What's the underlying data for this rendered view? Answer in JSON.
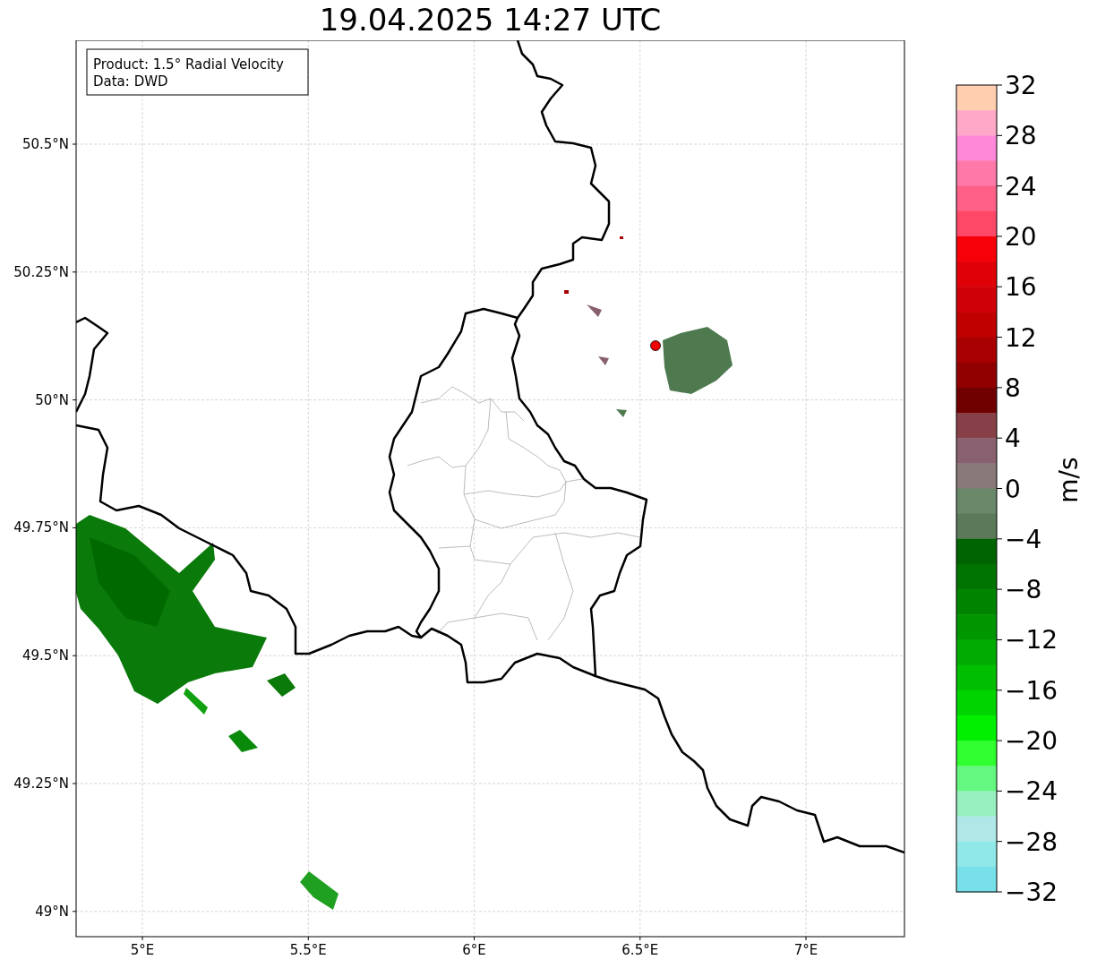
{
  "title": "19.04.2025 14:27 UTC",
  "legend": [
    "Product: 1.5° Radial Velocity",
    "Data: DWD"
  ],
  "axes": {
    "x_ticks": [
      "5°E",
      "5.5°E",
      "6°E",
      "6.5°E",
      "7°E"
    ],
    "y_ticks": [
      "50.5°N",
      "50.25°N",
      "50°N",
      "49.75°N",
      "49.5°N",
      "49.25°N",
      "49°N"
    ]
  },
  "colorbar": {
    "label": "m/s",
    "ticks": [
      "32",
      "28",
      "24",
      "20",
      "16",
      "12",
      "8",
      "4",
      "0",
      "−4",
      "−8",
      "−12",
      "−16",
      "−20",
      "−24",
      "−28",
      "−32"
    ],
    "bins": [
      {
        "color": "#ffcfb0"
      },
      {
        "color": "#ffa8c8"
      },
      {
        "color": "#ff88d8"
      },
      {
        "color": "#ff78a8"
      },
      {
        "color": "#ff6088"
      },
      {
        "color": "#ff4868"
      },
      {
        "color": "#f80008"
      },
      {
        "color": "#e00008"
      },
      {
        "color": "#d00008"
      },
      {
        "color": "#c00000"
      },
      {
        "color": "#a80000"
      },
      {
        "color": "#900000"
      },
      {
        "color": "#700000"
      },
      {
        "color": "#884048"
      },
      {
        "color": "#886070"
      },
      {
        "color": "#887878"
      },
      {
        "color": "#6a886a"
      },
      {
        "color": "#5a7a5a"
      },
      {
        "color": "#006400"
      },
      {
        "color": "#007400"
      },
      {
        "color": "#008400"
      },
      {
        "color": "#009600"
      },
      {
        "color": "#00aa00"
      },
      {
        "color": "#00be00"
      },
      {
        "color": "#00d400"
      },
      {
        "color": "#00f000"
      },
      {
        "color": "#30ff30"
      },
      {
        "color": "#64f880"
      },
      {
        "color": "#98f0c0"
      },
      {
        "color": "#b0e8e8"
      },
      {
        "color": "#90e8e8"
      },
      {
        "color": "#78e0e8"
      }
    ]
  }
}
